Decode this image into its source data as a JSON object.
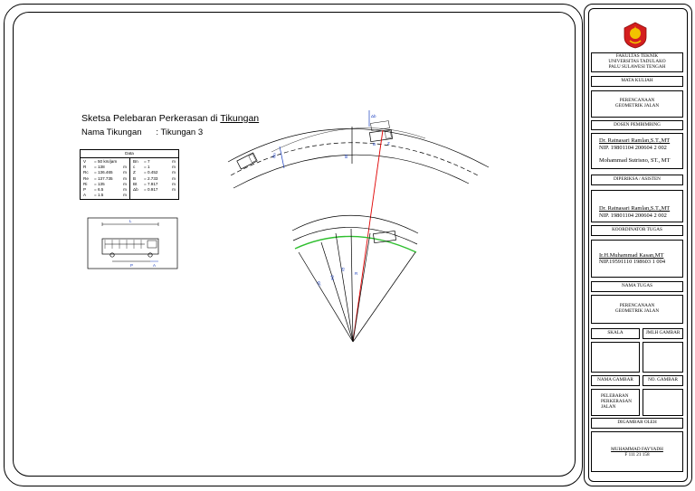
{
  "drawing": {
    "title_prefix": "Sketsa Pelebaran Perkerasan di ",
    "title_underlined": "Tikungan",
    "subtitle": "Nama Tikungan      : Tikungan 3",
    "table_header": "Data",
    "params_left": [
      {
        "k": "V",
        "v": "= 50  km/jam",
        "u": ""
      },
      {
        "k": "R",
        "v": "= 138",
        "u": "m"
      },
      {
        "k": "Rc",
        "v": "= 136.465",
        "u": "m"
      },
      {
        "k": "Re",
        "v": "= 137.735",
        "u": "m"
      },
      {
        "k": "Ri",
        "v": "= 135",
        "u": "m"
      },
      {
        "k": "P",
        "v": "= 6.5",
        "u": "m"
      },
      {
        "k": "A",
        "v": "= 1.5",
        "u": "m"
      }
    ],
    "params_right": [
      {
        "k": "Bn",
        "v": "= 7",
        "u": "m"
      },
      {
        "k": "c",
        "v": "= 1",
        "u": "m"
      },
      {
        "k": "Z",
        "v": "= 0.452",
        "u": "m"
      },
      {
        "k": "B",
        "v": "= 2.733",
        "u": "m"
      },
      {
        "k": "Bt",
        "v": "= 7.917",
        "u": "m"
      },
      {
        "k": "Δb",
        "v": "= 0.917",
        "u": "m"
      }
    ],
    "bus_dim_top": "L",
    "bus_dim_p": "P",
    "bus_dim_a": "A",
    "label_bt": "Bt",
    "label_db": "Δb",
    "label_bn": "Bn",
    "label_b": "B",
    "label_z": "Z",
    "label_rc": "Rc",
    "label_re": "Re",
    "label_ri": "Ri",
    "label_r": "R"
  },
  "title_block": {
    "faculty": [
      "FAKULTAS TEKNIK",
      "UNIVERSITAS TADULAKO",
      "PALU SULAWESI TENGAH"
    ],
    "course_label": "MATA KULIAH",
    "course_name": [
      "PERENCANAAN",
      "GEOMETRIK JALAN"
    ],
    "supervisor_label": "DOSEN PEMBIMBING",
    "supervisor_1": "Dr. Ratnasari Ramlan,S.T.,MT",
    "supervisor_1_nip": "NIP. 19801104 200604 2 002",
    "supervisor_2": "Mohammad Sutrisno, ST., MT",
    "checker_label": "DIPERIKSA / ASISTEN",
    "checker_name": "Dr. Ratnasari Ramlan,S.T.,MT",
    "checker_nip": "NIP. 19801104 200604 2 002",
    "coordinator_label": "KOORDINATOR  TUGAS",
    "coordinator_name": "Ir.H.Muhammad Kasan,MT",
    "coordinator_nip": "NIP.19591110 198603 1 004",
    "task_label": "NAMA TUGAS",
    "task_name": [
      "PERENCANAAN",
      "GEOMETRIK JALAN"
    ],
    "scale_label": "SKALA",
    "sheet_count_label": "JMLH GAMBAR",
    "drawing_name_label": "NAMA GAMBAR",
    "drawing_no_label": "NO. GAMBAR",
    "drawing_name": [
      "PELEBARAN",
      "PERKERASAN",
      "JALAN"
    ],
    "drawn_by_label": "DIGAMBAR OLEH",
    "drawn_by_name": "MUHAMMAD FAYYADH",
    "drawn_by_nim": "F 111 21 158"
  },
  "colors": {
    "ink": "#000000",
    "radius_line": "#e00000",
    "green_edge": "#2fbf2f",
    "logo_red": "#d41e1e",
    "logo_gold": "#f2c200"
  }
}
